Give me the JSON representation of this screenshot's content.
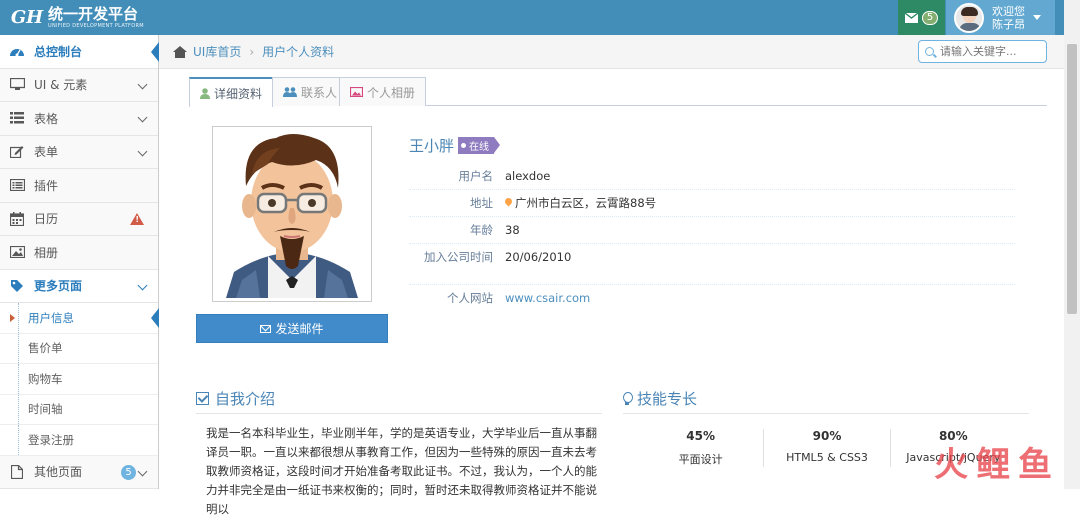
{
  "brand": {
    "logo": "GH",
    "title": "统一开发平台",
    "subtitle": "UNIFIED DEVELOPMENT PLATFORM"
  },
  "navbar": {
    "mail_badge": "5",
    "welcome": "欢迎您",
    "user_name": "陈子昂"
  },
  "sidebar": {
    "items": [
      {
        "label": "总控制台",
        "icon": "dashboard-icon"
      },
      {
        "label": "UI & 元素",
        "icon": "desktop-icon"
      },
      {
        "label": "表格",
        "icon": "list-icon"
      },
      {
        "label": "表单",
        "icon": "edit-icon"
      },
      {
        "label": "插件",
        "icon": "list-alt-icon"
      },
      {
        "label": "日历",
        "icon": "calendar-icon"
      },
      {
        "label": "相册",
        "icon": "picture-icon"
      },
      {
        "label": "更多页面",
        "icon": "tag-icon"
      }
    ],
    "sub_items": [
      "用户信息",
      "售价单",
      "购物车",
      "时间轴",
      "登录注册"
    ],
    "other": {
      "label": "其他页面",
      "badge": "5",
      "icon": "file-icon"
    }
  },
  "breadcrumb": {
    "home": "UI库首页",
    "current": "用户个人资料"
  },
  "search": {
    "placeholder": "请输入关键字..."
  },
  "tabs": [
    "详细资料",
    "联系人",
    "个人相册"
  ],
  "profile": {
    "name": "王小胖",
    "status": "在线",
    "rows": [
      {
        "label": "用户名",
        "value": "alexdoe"
      },
      {
        "label": "地址",
        "value": "广州市白云区，云霄路88号"
      },
      {
        "label": "年龄",
        "value": "38"
      },
      {
        "label": "加入公司时间",
        "value": "20/06/2010"
      }
    ],
    "website_label": "个人网站",
    "website": "www.csair.com",
    "send_button": "发送邮件"
  },
  "intro": {
    "title": "自我介绍",
    "text": "我是一名本科毕业生，毕业刚半年，学的是英语专业，大学毕业后一直从事翻译员一职。一直以来都很想从事教育工作，但因为一些特殊的原因一直未去考取教师资格证，这段时间才开始准备考取此证书。不过，我认为，一个人的能力并非完全是由一纸证书来权衡的；同时，暂时还未取得教师资格证并不能说明以"
  },
  "skills": {
    "title": "技能专长",
    "items": [
      {
        "pct": "45%",
        "name": "平面设计"
      },
      {
        "pct": "90%",
        "name": "HTML5 & CSS3"
      },
      {
        "pct": "80%",
        "name": "Javascript/jQuery"
      }
    ]
  },
  "watermark": "火鲤鱼",
  "colors": {
    "navbar": "#438eb9",
    "accent": "#2b7dbc",
    "status": "#8f7bbf",
    "button": "#428bca"
  }
}
